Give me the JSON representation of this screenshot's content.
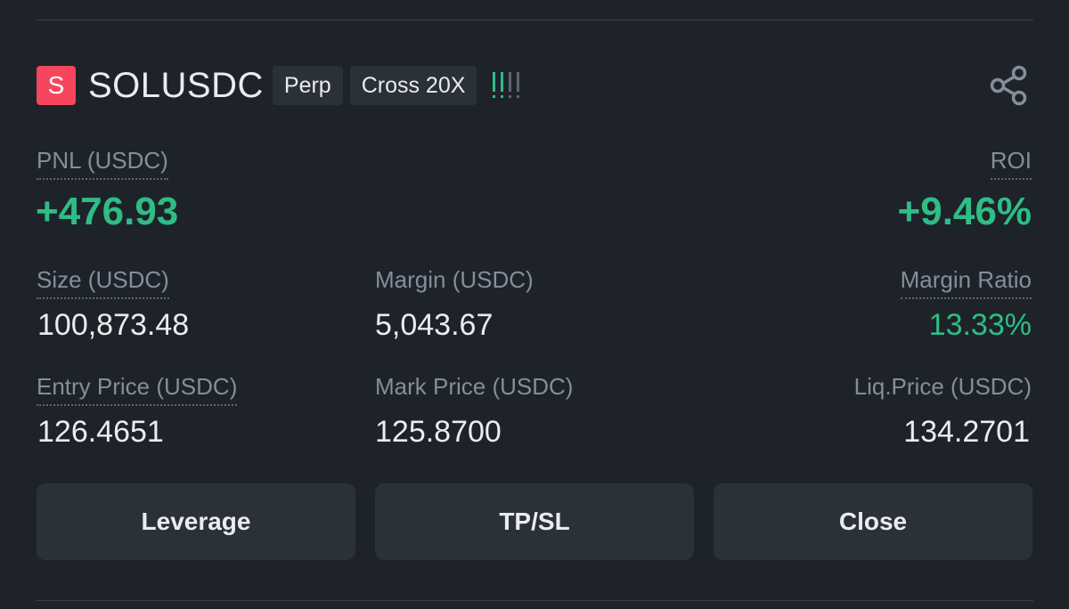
{
  "header": {
    "symbol_letter": "S",
    "symbol": "SOLUSDC",
    "tags": [
      "Perp",
      "Cross 20X"
    ]
  },
  "stats": {
    "pnl_label": "PNL (USDC)",
    "pnl_value": "+476.93",
    "roi_label": "ROI",
    "roi_value": "+9.46%",
    "size_label": "Size (USDC)",
    "size_value": "100,873.48",
    "margin_label": "Margin (USDC)",
    "margin_value": "5,043.67",
    "margin_ratio_label": "Margin Ratio",
    "margin_ratio_value": "13.33%",
    "entry_label": "Entry Price (USDC)",
    "entry_value": "126.4651",
    "mark_label": "Mark Price (USDC)",
    "mark_value": "125.8700",
    "liq_label": "Liq.Price (USDC)",
    "liq_value": "134.2701"
  },
  "buttons": {
    "leverage": "Leverage",
    "tpsl": "TP/SL",
    "close": "Close"
  },
  "icons": {
    "signal": "signal-strength-icon",
    "share": "share-icon"
  },
  "colors": {
    "background": "#1e2329",
    "positive": "#2ebd85",
    "short_badge": "#f6465d",
    "muted_text": "#848e9c",
    "button_bg": "#2b3139"
  }
}
